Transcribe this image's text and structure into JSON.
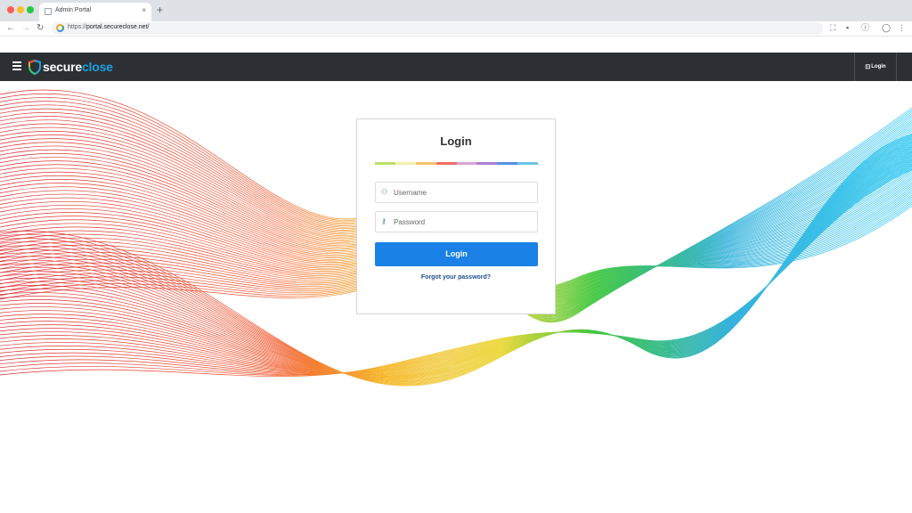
{
  "browser": {
    "tab_title": "Admin Portal",
    "tab_close": "×",
    "new_tab": "+",
    "url_scheme": "https://",
    "url_host": "portal.secureclose.net/"
  },
  "header": {
    "logo_text_primary": "secure",
    "logo_text_accent": "close",
    "login_label": "Login",
    "colors": {
      "bar": "#2c3035",
      "accent": "#1aa0dc"
    }
  },
  "login_card": {
    "title": "Login",
    "username_placeholder": "Username",
    "password_placeholder": "Password",
    "button_label": "Login",
    "forgot_link": "Forgot your password?",
    "stripe_colors": [
      "#b8e06a",
      "#f3f0b0",
      "#f5c36b",
      "#ee6e63",
      "#d9a3d6",
      "#b07ed3",
      "#5a8fe0",
      "#67c6e4"
    ],
    "button_color": "#1a82e6"
  },
  "icons": {
    "menu": "hamburger-icon",
    "user": "user-icon",
    "key": "key-icon",
    "login": "login-icon"
  }
}
